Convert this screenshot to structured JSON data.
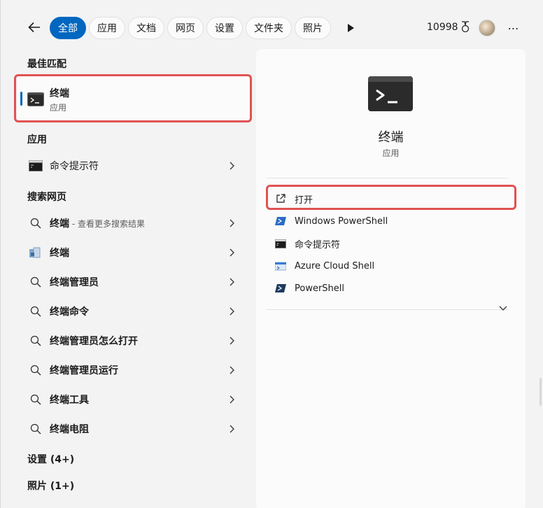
{
  "topbar": {
    "filters": [
      "全部",
      "应用",
      "文档",
      "网页",
      "设置",
      "文件夹",
      "照片"
    ],
    "points": "10998"
  },
  "left": {
    "best_match_title": "最佳匹配",
    "best_match": {
      "title": "终端",
      "subtitle": "应用"
    },
    "apps_title": "应用",
    "apps": [
      {
        "label": "命令提示符"
      }
    ],
    "web_title": "搜索网页",
    "web_first": {
      "label": "终端",
      "suffix": " - 查看更多搜索结果"
    },
    "web_second": {
      "label": "终端"
    },
    "web_rest": [
      "终端管理员",
      "终端命令",
      "终端管理员怎么打开",
      "终端管理员运行",
      "终端工具",
      "终端电阻"
    ],
    "settings_title": "设置 (4+)",
    "photos_title": "照片 (1+)"
  },
  "panel": {
    "title": "终端",
    "subtitle": "应用",
    "actions": [
      "打开",
      "Windows PowerShell",
      "命令提示符",
      "Azure Cloud Shell",
      "PowerShell"
    ]
  },
  "colors": {
    "accent": "#0067c0",
    "highlight": "#e05252",
    "terminal_icon": "#2b2b2b"
  }
}
